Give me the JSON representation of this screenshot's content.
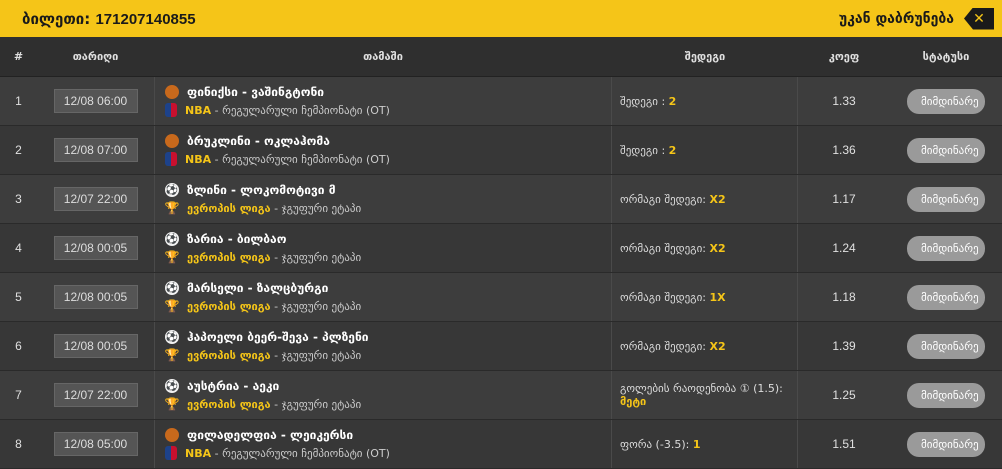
{
  "header": {
    "ticket_label": "ბილეთი:",
    "ticket_number": "171207140855",
    "back_label": "უკან დაბრუნება",
    "back_icon": "close-x-icon"
  },
  "columns": [
    "#",
    "თარიღი",
    "თამაში",
    "შედეგი",
    "კოეფ",
    "სტატუსი"
  ],
  "rows": [
    {
      "n": "1",
      "date": "12/08 06:00",
      "sport": "basketball",
      "title": "ფინიქსი - ვაშინგტონი",
      "league": "NBA",
      "sub": " - რეგულარული ჩემპიონატი (OT)",
      "result_label": "შედეგი : ",
      "result_value": "2",
      "koef": "1.33",
      "status": "მიმდინარე"
    },
    {
      "n": "2",
      "date": "12/08 07:00",
      "sport": "basketball",
      "title": "ბრუკლინი - ოკლაჰომა",
      "league": "NBA",
      "sub": " - რეგულარული ჩემპიონატი (OT)",
      "result_label": "შედეგი : ",
      "result_value": "2",
      "koef": "1.36",
      "status": "მიმდინარე"
    },
    {
      "n": "3",
      "date": "12/07 22:00",
      "sport": "football",
      "title": "ზლინი - ლოკომოტივი მ",
      "league": "ევროპის ლიგა",
      "sub": " - ჯგუფური ეტაპი",
      "result_label": "ორმაგი შედეგი: ",
      "result_value": "X2",
      "koef": "1.17",
      "status": "მიმდინარე"
    },
    {
      "n": "4",
      "date": "12/08 00:05",
      "sport": "football",
      "title": "ზარია - ბილბაო",
      "league": "ევროპის ლიგა",
      "sub": " - ჯგუფური ეტაპი",
      "result_label": "ორმაგი შედეგი: ",
      "result_value": "X2",
      "koef": "1.24",
      "status": "მიმდინარე"
    },
    {
      "n": "5",
      "date": "12/08 00:05",
      "sport": "football",
      "title": "მარსელი - ზალცბურგი",
      "league": "ევროპის ლიგა",
      "sub": " - ჯგუფური ეტაპი",
      "result_label": "ორმაგი შედეგი: ",
      "result_value": "1X",
      "koef": "1.18",
      "status": "მიმდინარე"
    },
    {
      "n": "6",
      "date": "12/08 00:05",
      "sport": "football",
      "title": "ჰაპოელი ბეერ-შევა - პლზენი",
      "league": "ევროპის ლიგა",
      "sub": " - ჯგუფური ეტაპი",
      "result_label": "ორმაგი შედეგი: ",
      "result_value": "X2",
      "koef": "1.39",
      "status": "მიმდინარე"
    },
    {
      "n": "7",
      "date": "12/07 22:00",
      "sport": "football",
      "title": "აუსტრია - აეკი",
      "league": "ევროპის ლიგა",
      "sub": " - ჯგუფური ეტაპი",
      "result_label": "გოლების რაოდენობა ① (1.5): ",
      "result_value": "მეტი",
      "koef": "1.25",
      "status": "მიმდინარე"
    },
    {
      "n": "8",
      "date": "12/08 05:00",
      "sport": "basketball",
      "title": "ფილადელფია - ლეიკერსი",
      "league": "NBA",
      "sub": " - რეგულარული ჩემპიონატი (OT)",
      "result_label": "ფორა (-3.5): ",
      "result_value": "1",
      "koef": "1.51",
      "status": "მიმდინარე"
    }
  ]
}
